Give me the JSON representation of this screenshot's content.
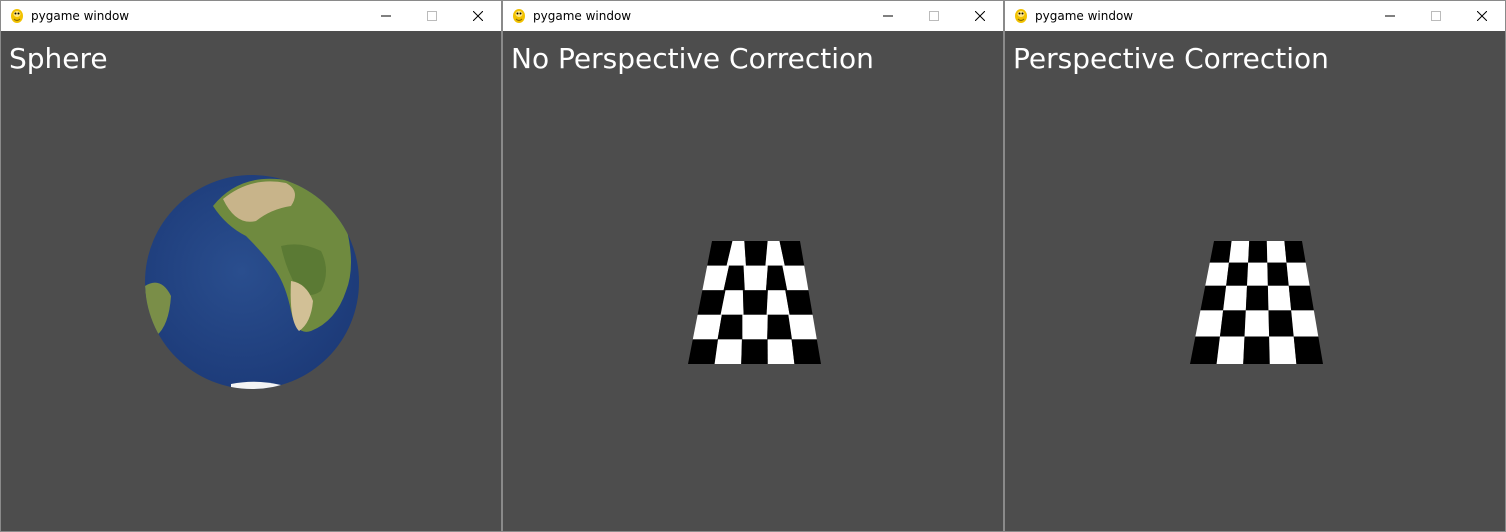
{
  "windows": [
    {
      "title": "pygame window",
      "caption": "Sphere",
      "scene": "textured-globe",
      "background_color": "#4d4d4d"
    },
    {
      "title": "pygame window",
      "caption": "No Perspective Correction",
      "scene": "checkerboard-affine",
      "background_color": "#4d4d4d"
    },
    {
      "title": "pygame window",
      "caption": "Perspective Correction",
      "scene": "checkerboard-perspective",
      "background_color": "#4d4d4d"
    }
  ],
  "controls": {
    "minimize_icon": "minimize-icon",
    "maximize_icon": "maximize-icon",
    "close_icon": "close-icon"
  },
  "colors": {
    "ocean": "#1f3f7f",
    "land": "#6f8a3f",
    "desert": "#c8b48a",
    "checker_dark": "#000000",
    "checker_light": "#ffffff",
    "caption_text": "#ffffff"
  }
}
